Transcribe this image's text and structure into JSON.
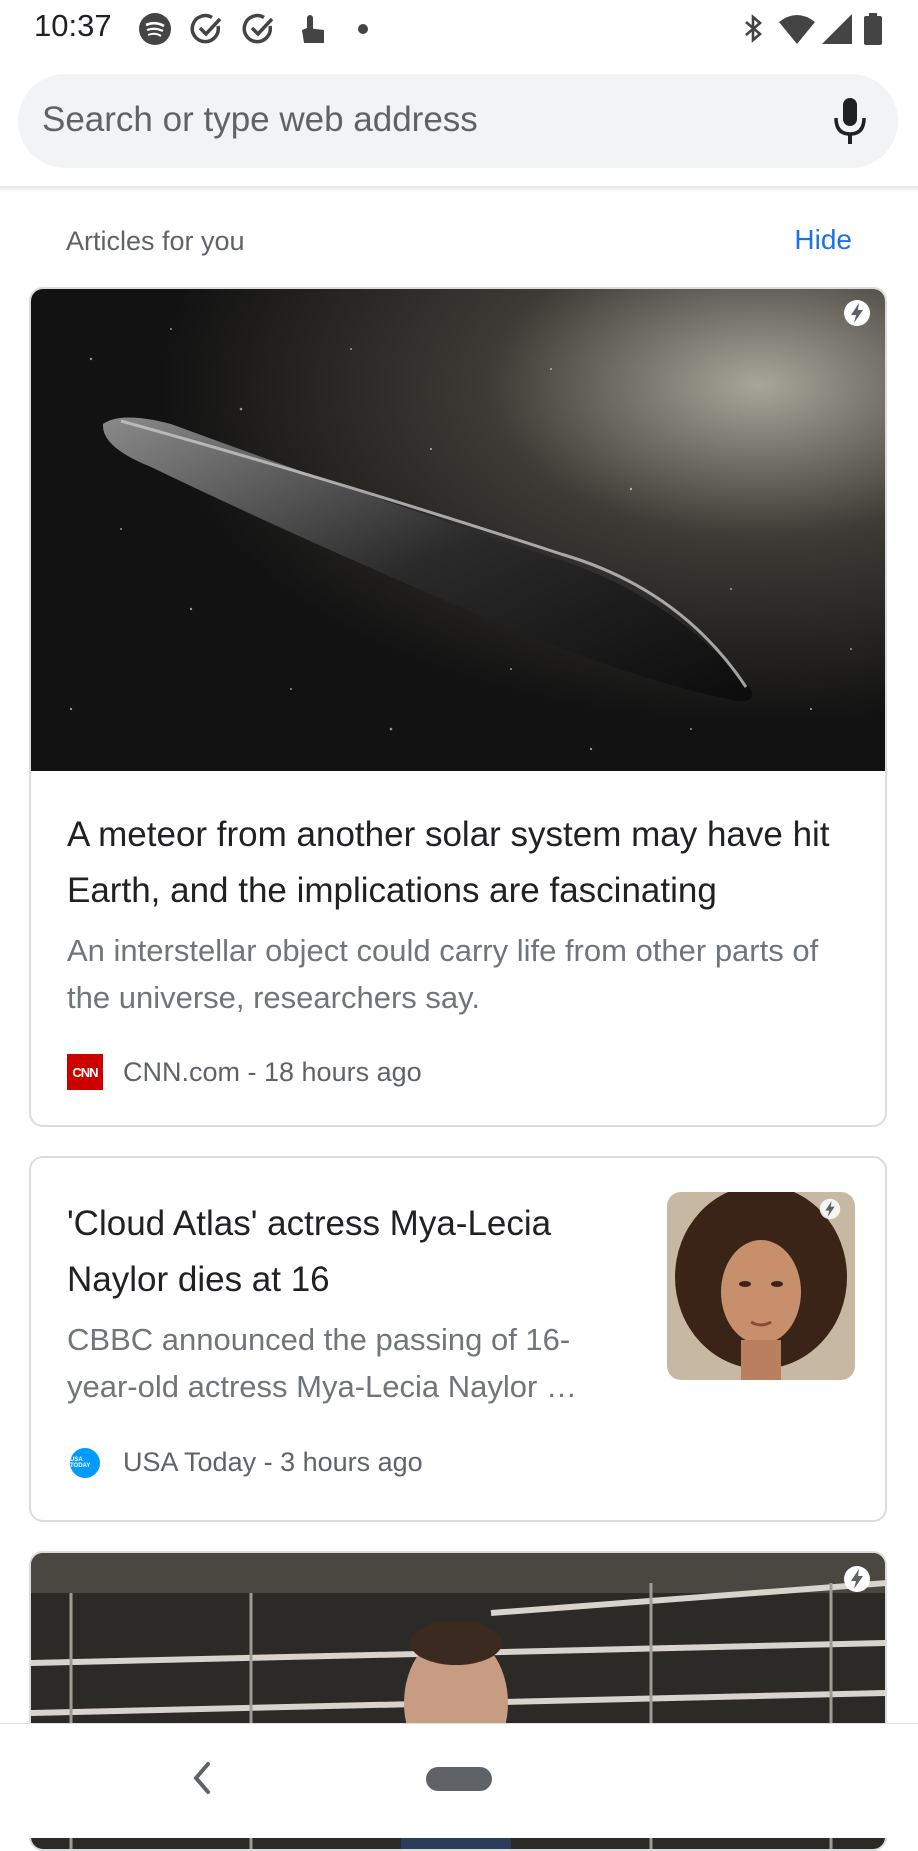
{
  "status_bar": {
    "time": "10:37",
    "left_icons": [
      "spotify-icon",
      "check-circle-icon",
      "check-circle-icon",
      "touch-icon",
      "dot-icon"
    ],
    "right_icons": [
      "bluetooth-icon",
      "wifi-icon",
      "signal-icon",
      "battery-icon"
    ]
  },
  "search": {
    "placeholder": "Search or type web address",
    "mic_icon": "mic-icon"
  },
  "feed": {
    "section_title": "Articles for you",
    "hide_label": "Hide",
    "articles": [
      {
        "headline": "A meteor from another solar system may have hit Earth, and the implications are fascinating",
        "snippet": "An interstellar object could carry life from other parts of the universe, researchers say.",
        "source": "CNN.com - 18 hours ago",
        "logo_text": "CNN",
        "image": "interstellar-object-image"
      },
      {
        "headline": "'Cloud Atlas' actress Mya-Lecia Naylor dies at 16",
        "snippet": "CBBC announced the passing of 16-year-old actress Mya-Lecia Naylor …",
        "source": "USA Today - 3 hours ago",
        "logo_text": "USA TODAY",
        "image": "actress-portrait-image"
      },
      {
        "image": "man-in-warehouse-image"
      }
    ]
  },
  "colors": {
    "accent": "#1a73e8",
    "cnn_red": "#cc0000",
    "usa_today_blue": "#009bff"
  }
}
